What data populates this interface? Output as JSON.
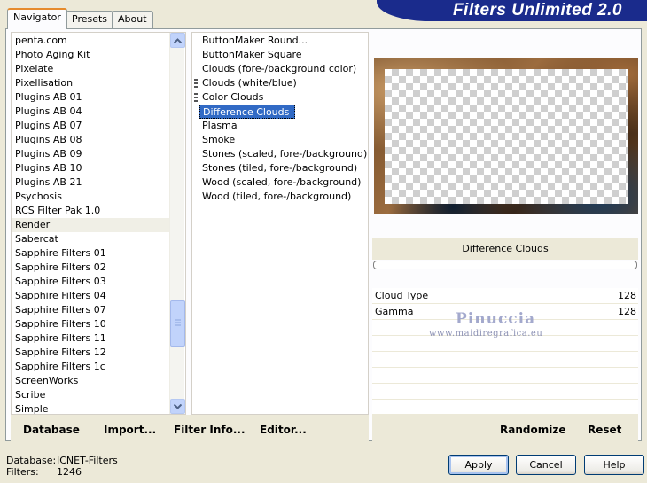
{
  "app": {
    "title": "Filters Unlimited 2.0"
  },
  "tabs": [
    {
      "label": "Navigator",
      "active": true
    },
    {
      "label": "Presets",
      "active": false
    },
    {
      "label": "About",
      "active": false
    }
  ],
  "categories": {
    "items": [
      "penta.com",
      "Photo Aging Kit",
      "Pixelate",
      "Pixellisation",
      "Plugins AB 01",
      "Plugins AB 04",
      "Plugins AB 07",
      "Plugins AB 08",
      "Plugins AB 09",
      "Plugins AB 10",
      "Plugins AB 21",
      "Psychosis",
      "RCS Filter Pak 1.0",
      "Render",
      "Sabercat",
      "Sapphire Filters 01",
      "Sapphire Filters 02",
      "Sapphire Filters 03",
      "Sapphire Filters 04",
      "Sapphire Filters 07",
      "Sapphire Filters 10",
      "Sapphire Filters 11",
      "Sapphire Filters 12",
      "Sapphire Filters 1c",
      "ScreenWorks",
      "Scribe",
      "Simple"
    ],
    "selected": "Render"
  },
  "filters": {
    "items": [
      {
        "label": "ButtonMaker Round...",
        "marker": false
      },
      {
        "label": "ButtonMaker Square",
        "marker": false
      },
      {
        "label": "Clouds (fore-/background color)",
        "marker": false
      },
      {
        "label": "Clouds (white/blue)",
        "marker": true
      },
      {
        "label": "Color Clouds",
        "marker": true
      },
      {
        "label": "Difference Clouds",
        "marker": false,
        "selected": true
      },
      {
        "label": "Plasma",
        "marker": false
      },
      {
        "label": "Smoke",
        "marker": false
      },
      {
        "label": "Stones (scaled, fore-/background)",
        "marker": false
      },
      {
        "label": "Stones (tiled, fore-/background)",
        "marker": false
      },
      {
        "label": "Wood (scaled, fore-/background)",
        "marker": false
      },
      {
        "label": "Wood (tiled, fore-/background)",
        "marker": false
      }
    ]
  },
  "preview": {
    "filter_name": "Difference Clouds",
    "progress_percent": 0
  },
  "parameters": [
    {
      "name": "Cloud Type",
      "value": "128"
    },
    {
      "name": "Gamma",
      "value": "128"
    }
  ],
  "watermark": {
    "name": "Pinuccia",
    "url": "www.maidiregrafica.eu"
  },
  "left_actions": {
    "database": "Database",
    "import": "Import...",
    "filter_info": "Filter Info...",
    "editor": "Editor..."
  },
  "right_actions": {
    "randomize": "Randomize",
    "reset": "Reset"
  },
  "status": {
    "database_label": "Database:",
    "database_value": "ICNET-Filters",
    "filters_label": "Filters:",
    "filters_value": "1246"
  },
  "dialog_buttons": {
    "apply": "Apply",
    "cancel": "Cancel",
    "help": "Help"
  },
  "colors": {
    "banner": "#1a2b8c",
    "selection": "#316ac5",
    "window_bg": "#ece9d8"
  }
}
